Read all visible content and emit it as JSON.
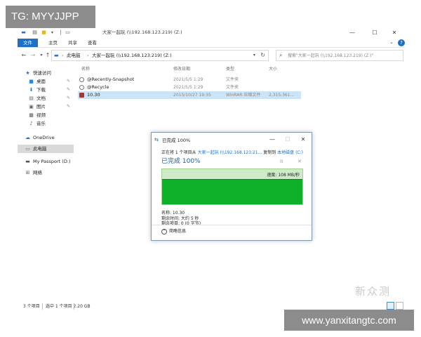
{
  "overlay": {
    "tg_label": "TG: MYYJJPP",
    "url_label": "www.yanxitangtc.com",
    "watermark": "新众测"
  },
  "titlebar": {
    "title": "大家一起玩 (\\\\192.168.123.219) (Z:)",
    "controls": {
      "minimize": "—",
      "maximize": "☐",
      "close": "✕"
    }
  },
  "ribbon": {
    "tabs": [
      "文件",
      "主页",
      "共享",
      "查看"
    ],
    "expand": "⌄",
    "help": "?"
  },
  "address": {
    "segments": [
      "此电脑",
      "大家一起玩 (\\\\192.168.123.219) (Z:)"
    ],
    "search_placeholder": "搜索\"大家一起玩 (\\\\192.168.123.219) (Z:)\""
  },
  "nav": {
    "items": [
      {
        "label": "快速访问",
        "icon": "star-icon",
        "glyph": "★",
        "color": "#2a6fc9"
      },
      {
        "label": "桌面",
        "icon": "desktop-icon",
        "glyph": "■",
        "color": "#2a8ad8",
        "pinned": true
      },
      {
        "label": "下载",
        "icon": "download-icon",
        "glyph": "⬇",
        "color": "#2a6fc9",
        "pinned": true
      },
      {
        "label": "文档",
        "icon": "document-icon",
        "glyph": "▤",
        "color": "#666666",
        "pinned": true
      },
      {
        "label": "图片",
        "icon": "picture-icon",
        "glyph": "▣",
        "color": "#666666",
        "pinned": true
      },
      {
        "label": "视频",
        "icon": "video-icon",
        "glyph": "▦",
        "color": "#555555"
      },
      {
        "label": "音乐",
        "icon": "music-icon",
        "glyph": "♪",
        "color": "#2a6fc9"
      },
      {
        "label": "OneDrive",
        "icon": "cloud-icon",
        "glyph": "☁",
        "color": "#1f6fc5"
      },
      {
        "label": "此电脑",
        "icon": "computer-icon",
        "glyph": "▭",
        "color": "#2a6fc9",
        "selected": true
      },
      {
        "label": "My Passport (D:)",
        "icon": "drive-icon",
        "glyph": "▬",
        "color": "#555555"
      },
      {
        "label": "网络",
        "icon": "network-icon",
        "glyph": "⊞",
        "color": "#2a6fc9"
      }
    ],
    "pin_glyph": "✎"
  },
  "filelist": {
    "columns": [
      "名称",
      "修改日期",
      "类型",
      "大小"
    ],
    "rows": [
      {
        "name": "@Recently-Snapshot",
        "date": "2021/5/5 1:29",
        "type": "文件夹",
        "size": "",
        "icon": "snapshot-folder-icon"
      },
      {
        "name": "@Recycle",
        "date": "2021/5/5 1:29",
        "type": "文件夹",
        "size": "",
        "icon": "recycle-folder-icon"
      },
      {
        "name": "10.30",
        "date": "2015/10/27 19:35",
        "type": "WinRAR 压缩文件",
        "size": "2,315,361...",
        "icon": "rar-archive-icon",
        "selected": true
      }
    ]
  },
  "status": {
    "count": "3 个项目",
    "selection": "选中 1 个项目  2.20 GB"
  },
  "dialog": {
    "title": "已完成 100%",
    "progress_text_prefix": "正在将 1 个项目从",
    "progress_source": "大家一起玩 (\\\\192.168.123.21...",
    "progress_middle": "复制到",
    "progress_dest": "本地磁盘 (C:)",
    "percent_label": "已完成 100%",
    "percent": 100,
    "speed": "速度: 108 MB/秒",
    "info_name": "名称: 10.30",
    "info_time": "剩余时间: 大约 5 秒",
    "info_items": "剩余项目: 0 (0 字节)",
    "less_info": "简略信息",
    "pause_glyph": "II",
    "cancel_glyph": "✕"
  }
}
